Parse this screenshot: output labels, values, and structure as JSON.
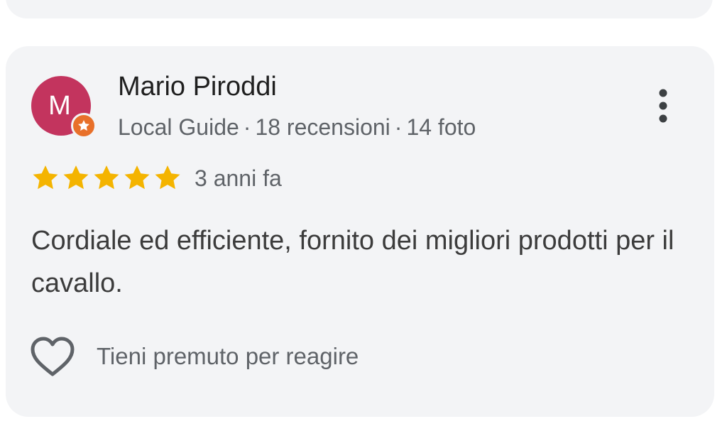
{
  "review": {
    "author": {
      "name": "Mario Piroddi",
      "initial": "M",
      "avatar_color": "#c3345e",
      "badge_color": "#e8702a",
      "badge_icon": "local-guide-star-icon",
      "role": "Local Guide",
      "reviews_count": "18 recensioni",
      "photos_count": "14 foto",
      "separator": "·"
    },
    "rating": 5,
    "rating_max": 5,
    "star_color": "#f4b400",
    "time_ago": "3 anni fa",
    "text": "Cordiale ed efficiente, fornito dei migliori prodotti per il cavallo.",
    "reaction": {
      "icon": "heart-outline-icon",
      "label": "Tieni premuto per reagire"
    },
    "more_icon": "more-vert-icon"
  }
}
